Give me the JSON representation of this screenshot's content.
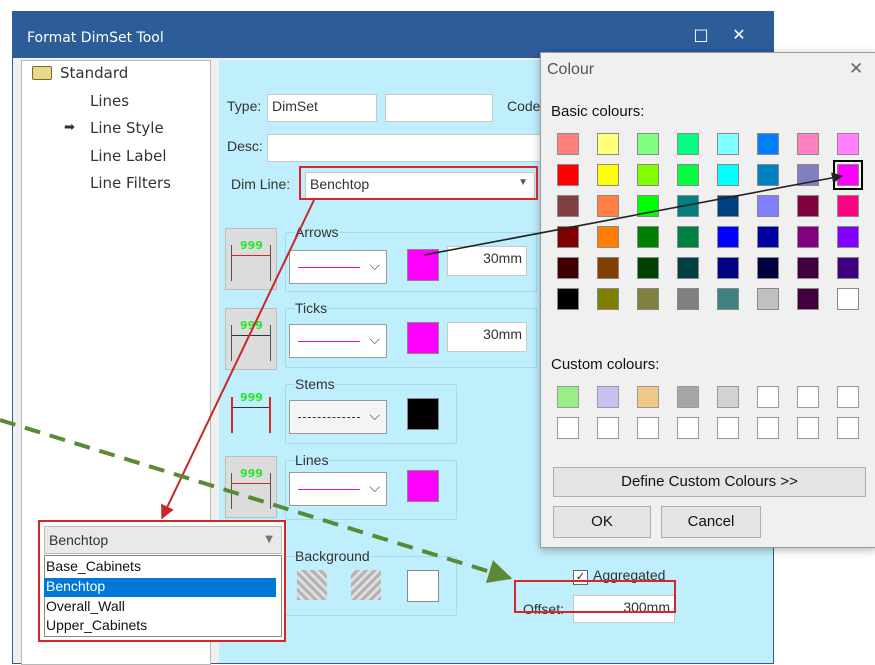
{
  "window": {
    "title": "Format DimSet Tool",
    "maximize_glyph": "□",
    "close_glyph": "✕"
  },
  "tree": {
    "root": "Standard",
    "items": [
      {
        "label": "Lines",
        "selected": false
      },
      {
        "label": "Line Style",
        "selected": true
      },
      {
        "label": "Line Label",
        "selected": false
      },
      {
        "label": "Line Filters",
        "selected": false
      }
    ],
    "selected_marker": "➡"
  },
  "form": {
    "type_label": "Type:",
    "type_value": "DimSet",
    "type_extra_value": "",
    "code_label": "Code",
    "desc_label": "Desc:",
    "desc_value": "",
    "dimline_label": "Dim Line:",
    "dimline_value": "Benchtop",
    "thumb_text": "999",
    "arrows_label": "Arrows",
    "arrows_size": "30mm",
    "arrows_color": "#ff00ff",
    "ticks_label": "Ticks",
    "ticks_size": "30mm",
    "ticks_color": "#ff00ff",
    "stems_label": "Stems",
    "stems_color": "#000000",
    "lines_label": "Lines",
    "lines_color": "#ff00ff",
    "background_label": "Background",
    "background_color": "#ffffff",
    "aggregated_label": "Aggregated",
    "aggregated_checked": true,
    "offset_label": "Offset:",
    "offset_value": "300mm"
  },
  "dropdown": {
    "selected": "Benchtop",
    "options": [
      "Base_Cabinets",
      "Benchtop",
      "Overall_Wall",
      "Upper_Cabinets"
    ],
    "highlight_index": 1,
    "highlight_color": "#0078d7"
  },
  "colour_dialog": {
    "title": "Colour",
    "close_glyph": "✕",
    "basic_label": "Basic colours:",
    "basic": [
      [
        "#ff8080",
        "#ffff80",
        "#80ff80",
        "#00ff80",
        "#80ffff",
        "#0080ff",
        "#ff80c0",
        "#ff80ff"
      ],
      [
        "#ff0000",
        "#ffff00",
        "#80ff00",
        "#00ff40",
        "#00ffff",
        "#0080c0",
        "#8080c0",
        "#ff00ff"
      ],
      [
        "#804040",
        "#ff8040",
        "#00ff00",
        "#008080",
        "#004080",
        "#8080ff",
        "#800040",
        "#ff0080"
      ],
      [
        "#800000",
        "#ff8000",
        "#008000",
        "#008040",
        "#0000ff",
        "#0000a0",
        "#800080",
        "#8000ff"
      ],
      [
        "#400000",
        "#804000",
        "#004000",
        "#004040",
        "#000080",
        "#000040",
        "#400040",
        "#400080"
      ],
      [
        "#000000",
        "#808000",
        "#808040",
        "#808080",
        "#408080",
        "#c0c0c0",
        "#400040",
        "#ffffff"
      ]
    ],
    "selected_row": 1,
    "selected_col": 7,
    "custom_label": "Custom colours:",
    "custom": [
      [
        "#99ee88",
        "#c8c0f0",
        "#f0c888",
        "#a6a6a6",
        "#d2d2d2",
        "#ffffff",
        "#ffffff",
        "#ffffff"
      ],
      [
        "#ffffff",
        "#ffffff",
        "#ffffff",
        "#ffffff",
        "#ffffff",
        "#ffffff",
        "#ffffff",
        "#ffffff"
      ]
    ],
    "define_label": "Define Custom Colours >>",
    "ok_label": "OK",
    "cancel_label": "Cancel"
  },
  "annotations": {
    "highlight_color": "#d62626",
    "arrow_color": "#c62828",
    "dashed_color": "#5a8a35"
  }
}
